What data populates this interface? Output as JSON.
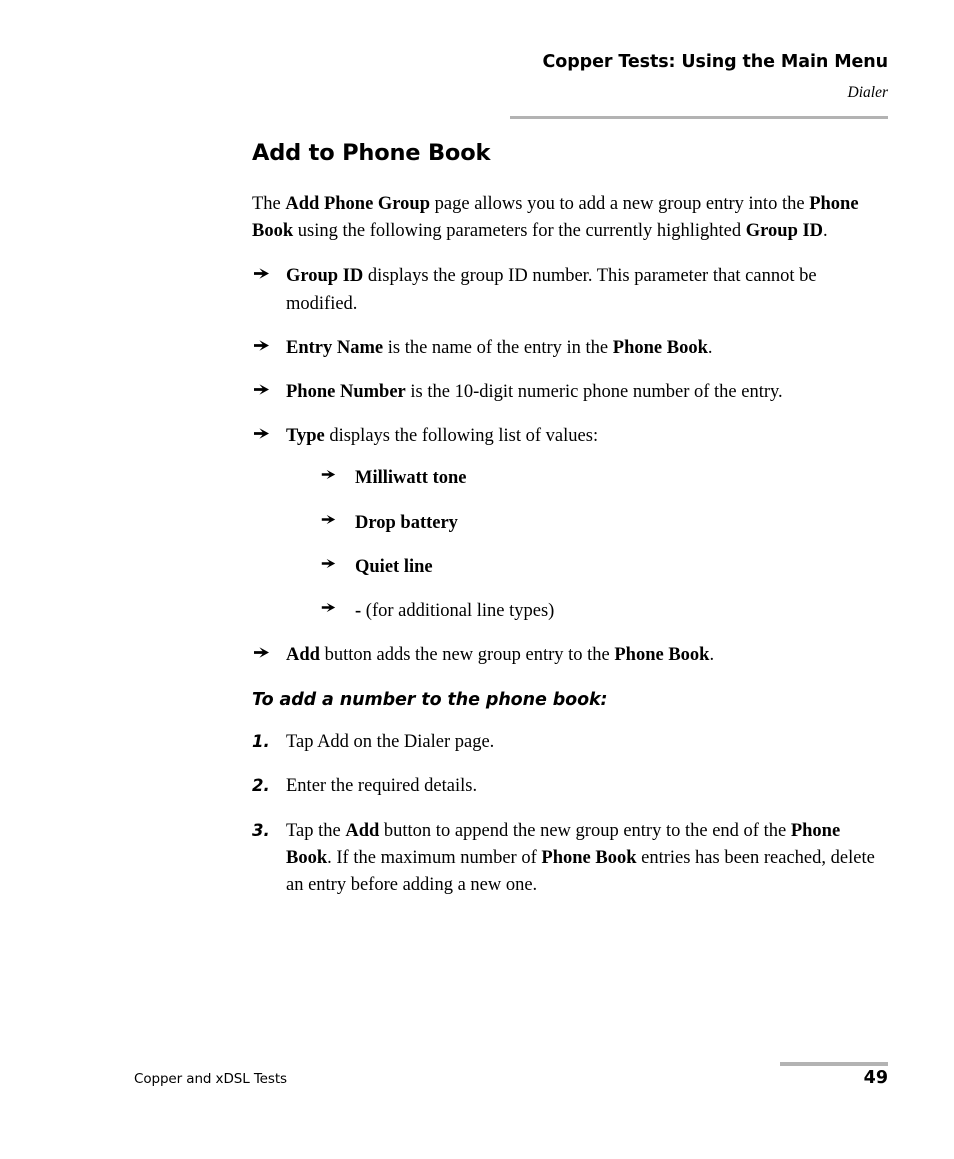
{
  "header": {
    "title": "Copper Tests: Using the Main Menu",
    "subtitle": "Dialer"
  },
  "section": {
    "title": "Add to Phone Book",
    "intro": {
      "part1": "The ",
      "bold1": "Add Phone Group",
      "part2": " page allows you to add a new group entry into the ",
      "bold2": "Phone Book",
      "part3": " using the following parameters for the currently highlighted ",
      "bold3": "Group ID",
      "part4": "."
    },
    "bullets": [
      {
        "bold_lead": "Group ID",
        "text": " displays the group ID number. This parameter that cannot be modified."
      },
      {
        "bold_lead": "Entry Name",
        "text": " is the name of the entry in the ",
        "bold_tail": "Phone Book",
        "tail_text": "."
      },
      {
        "bold_lead": "Phone Number",
        "text": " is the 10-digit numeric phone number of the entry."
      },
      {
        "bold_lead": "Type",
        "text": " displays the following list of values:",
        "subbullets": [
          {
            "bold_lead": "Milliwatt tone",
            "text": ""
          },
          {
            "bold_lead": "Drop battery",
            "text": ""
          },
          {
            "bold_lead": "Quiet line",
            "text": ""
          },
          {
            "bold_lead": "-",
            "text": " (for additional line types)"
          }
        ]
      },
      {
        "bold_lead": "Add",
        "text": " button adds the new group entry to the ",
        "bold_tail": "Phone Book",
        "tail_text": "."
      }
    ],
    "procedure": {
      "title": "To add a number to the phone book:",
      "steps": [
        {
          "number": "1.",
          "text": "Tap Add on the Dialer page."
        },
        {
          "number": "2.",
          "text": "Enter the required details."
        },
        {
          "number": "3.",
          "part1": "Tap the ",
          "bold1": "Add",
          "part2": " button to append the new group entry to the end of the ",
          "bold2": "Phone Book",
          "part3": ". If the maximum number of ",
          "bold3": "Phone Book",
          "part4": " entries has been reached, delete an entry before adding a new one."
        }
      ]
    }
  },
  "footer": {
    "left": "Copper and xDSL Tests",
    "page": "49"
  },
  "colors": {
    "rule": "#b3b3b3",
    "text": "#000000",
    "background": "#ffffff"
  }
}
